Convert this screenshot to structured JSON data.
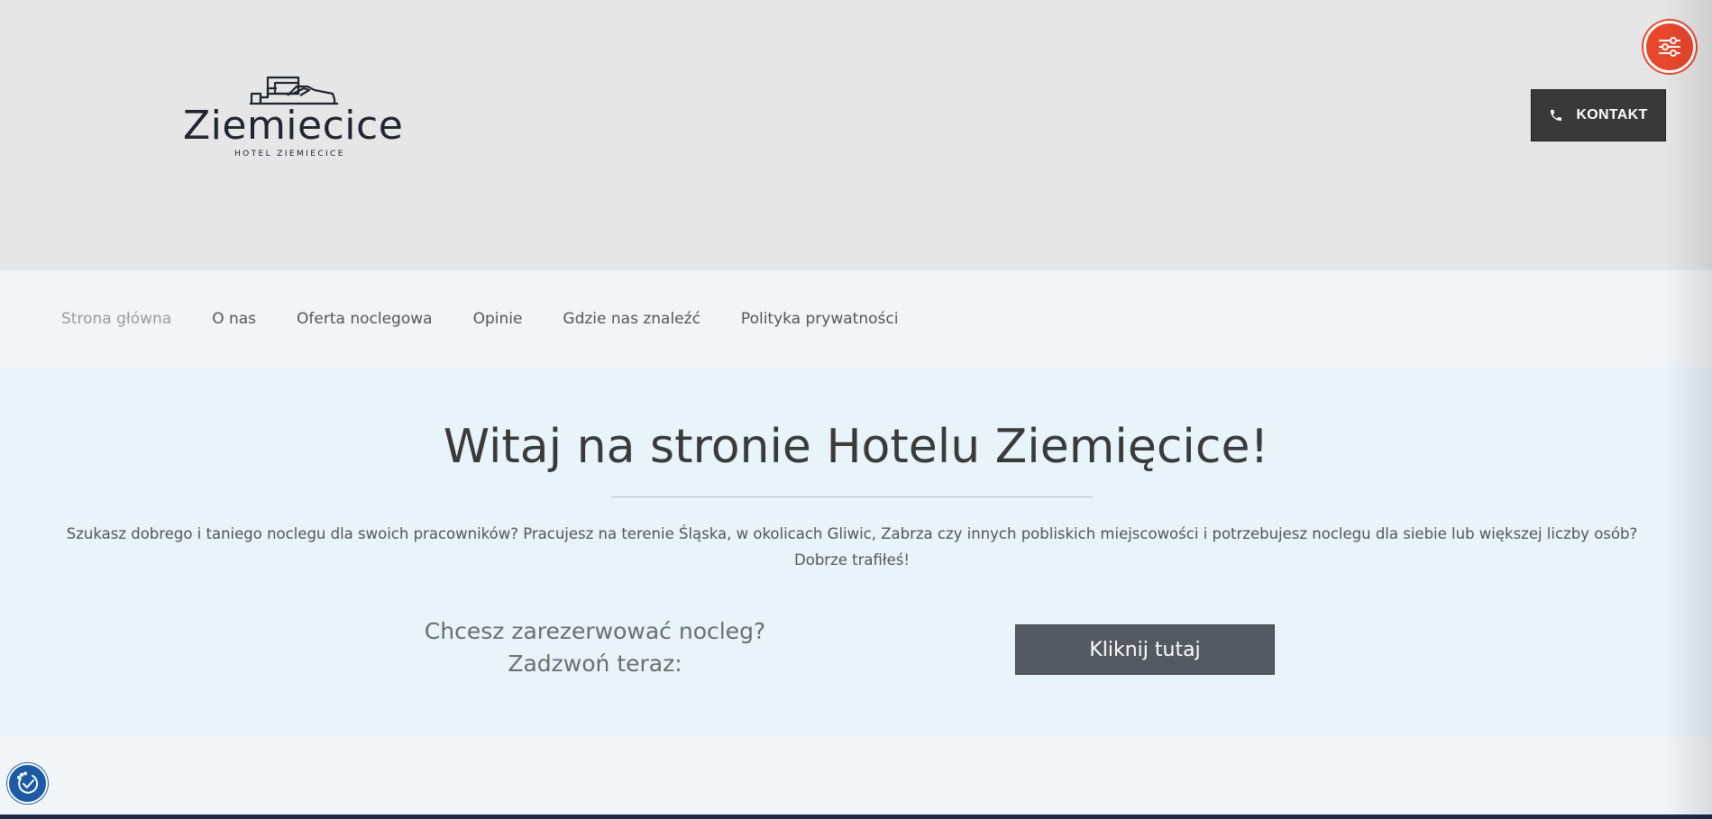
{
  "brand": {
    "name": "Ziemiecice",
    "subtitle": "HOTEL ZIEMIECICE"
  },
  "header": {
    "contact_label": "KONTAKT",
    "contact_icon": "phone-icon",
    "settings_icon": "sliders-icon"
  },
  "nav": {
    "items": [
      {
        "label": "Strona główna",
        "active": true
      },
      {
        "label": "O nas",
        "active": false
      },
      {
        "label": "Oferta noclegowa",
        "active": false
      },
      {
        "label": "Opinie",
        "active": false
      },
      {
        "label": "Gdzie nas znaleźć",
        "active": false
      },
      {
        "label": "Polityka prywatności",
        "active": false
      }
    ]
  },
  "hero": {
    "title": "Witaj na stronie Hotelu Ziemięcice!",
    "text": "Szukasz dobrego i taniego noclegu dla swoich pracowników? Pracujesz na terenie Śląska, w okolicach Gliwic, Zabrza czy innych pobliskich miejscowości i potrzebujesz noclegu dla siebie lub większej liczby osób? Dobrze trafiłeś!",
    "cta_line1": "Chcesz zarezerwować nocleg?",
    "cta_line2": "Zadzwoń teraz:",
    "cta_button": "Kliknij tutaj"
  },
  "accessibility": {
    "icon": "accessibility-check-icon"
  },
  "colors": {
    "header_bg": "#e6e6e6",
    "hero_bg": "#e8f3fa",
    "accent_orange": "#e8472c",
    "button_dark": "#393939",
    "cta_button": "#555a62",
    "a11y_blue": "#1c5aa6"
  }
}
